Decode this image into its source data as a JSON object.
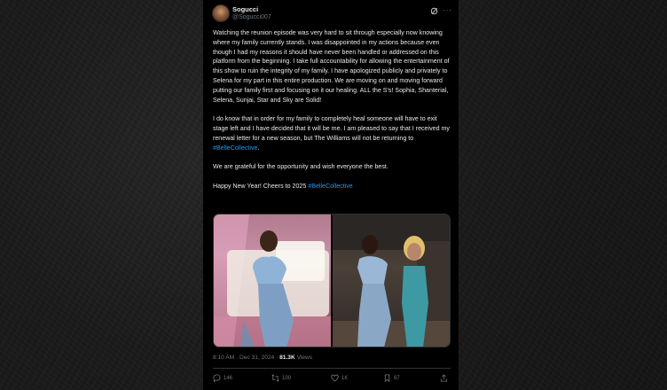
{
  "tweet": {
    "display_name": "Sogucci",
    "handle": "@Sogucci007",
    "paragraphs": [
      "Watching the reunion episode was very hard to sit through especially now knowing where my family currently stands. I was disappointed in my actions because even though I had my reasons it should have never been handled or addressed on this platform from the beginning. I take full accountability for allowing the entertainment of this show to ruin the integrity of my family. I have apologized publicly and privately to Selena for my part in this entire production. We are moving on and moving forward putting our family first and focusing on it our healing. ALL the S's! Sophia, Shanterial, Selena, Sunjai, Star and Sky are Solid!",
      "I do know that in order for my family to completely heal someone will have to exit stage left and I have decided that it will be me. I am pleased to say that I received my renewal letter for a new season, but The Williams will not be returning to ",
      "We are grateful for the opportunity and wish everyone the best.",
      "Happy New Year! Cheers to 2025 "
    ],
    "hashtag": "#BelleCollective",
    "p2_end": ".",
    "timestamp": "8:10 AM · Dec 31, 2024 · ",
    "views_count": "81.3K",
    "views_label": " Views"
  },
  "actions": {
    "replies": "146",
    "reposts": "100",
    "likes": "1K",
    "bookmarks": "67"
  },
  "icons": [
    "grok-icon",
    "more-icon",
    "reply-icon",
    "repost-icon",
    "like-icon",
    "bookmark-icon",
    "share-icon"
  ],
  "colors": {
    "background": "#000000",
    "text": "#e7e9ea",
    "muted": "#71767b",
    "link": "#1d9bf0"
  }
}
